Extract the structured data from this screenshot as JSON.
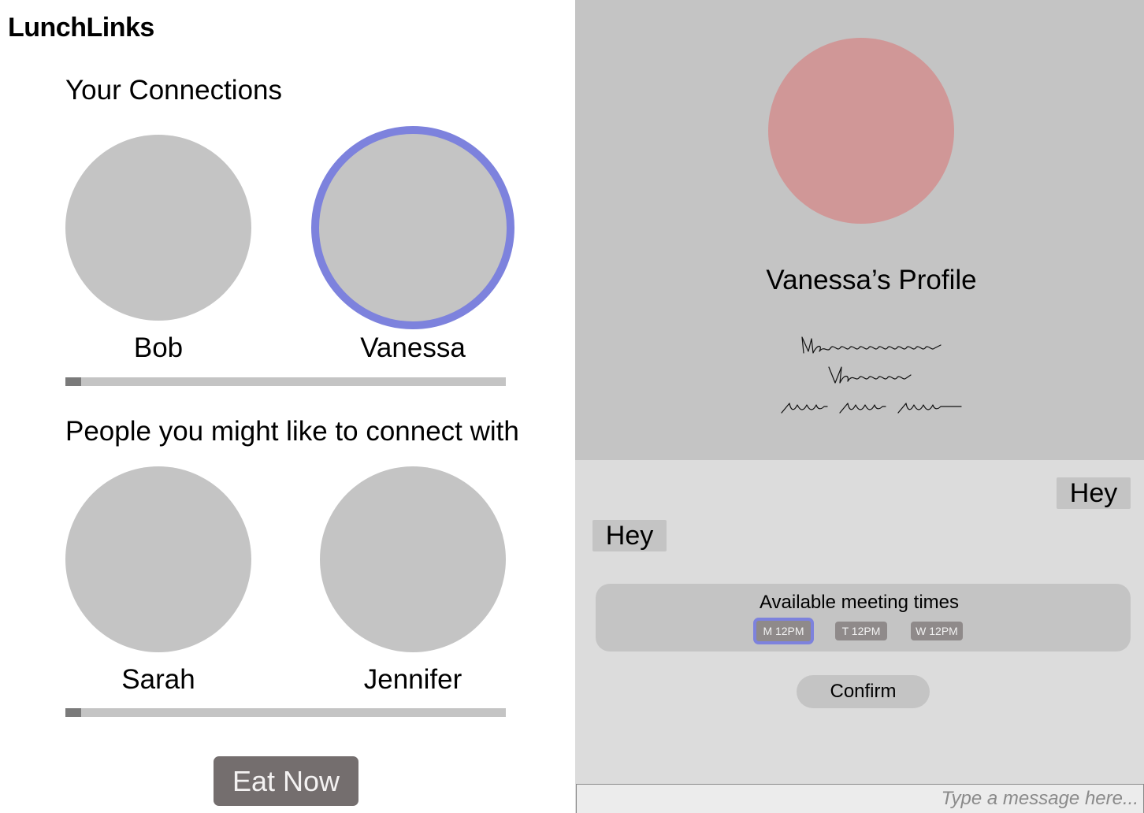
{
  "app": {
    "title": "LunchLinks"
  },
  "connections": {
    "heading": "Your Connections",
    "people": [
      {
        "name": "Bob",
        "selected": false
      },
      {
        "name": "Vanessa",
        "selected": true
      }
    ],
    "scroll_position": 0.036
  },
  "suggestions": {
    "heading": "People you might like to connect with",
    "people": [
      {
        "name": "Sarah"
      },
      {
        "name": "Jennifer"
      }
    ],
    "scroll_position": 0.036
  },
  "actions": {
    "eat_now_label": "Eat Now"
  },
  "profile": {
    "title": "Vanessa’s Profile",
    "avatar_color": "#d09797"
  },
  "chat": {
    "messages": [
      {
        "direction": "sent",
        "text": "Hey"
      },
      {
        "direction": "received",
        "text": "Hey"
      }
    ],
    "meeting_times": {
      "title": "Available meeting times",
      "options": [
        {
          "label": "M 12PM",
          "selected": true
        },
        {
          "label": "T 12PM",
          "selected": false
        },
        {
          "label": "W 12PM",
          "selected": false
        }
      ]
    },
    "confirm_label": "Confirm",
    "input_placeholder": "Type a message here..."
  },
  "colors": {
    "selection_accent": "#7d82dd",
    "avatar_placeholder": "#c4c4c4",
    "eat_now_button": "#746e6e"
  }
}
